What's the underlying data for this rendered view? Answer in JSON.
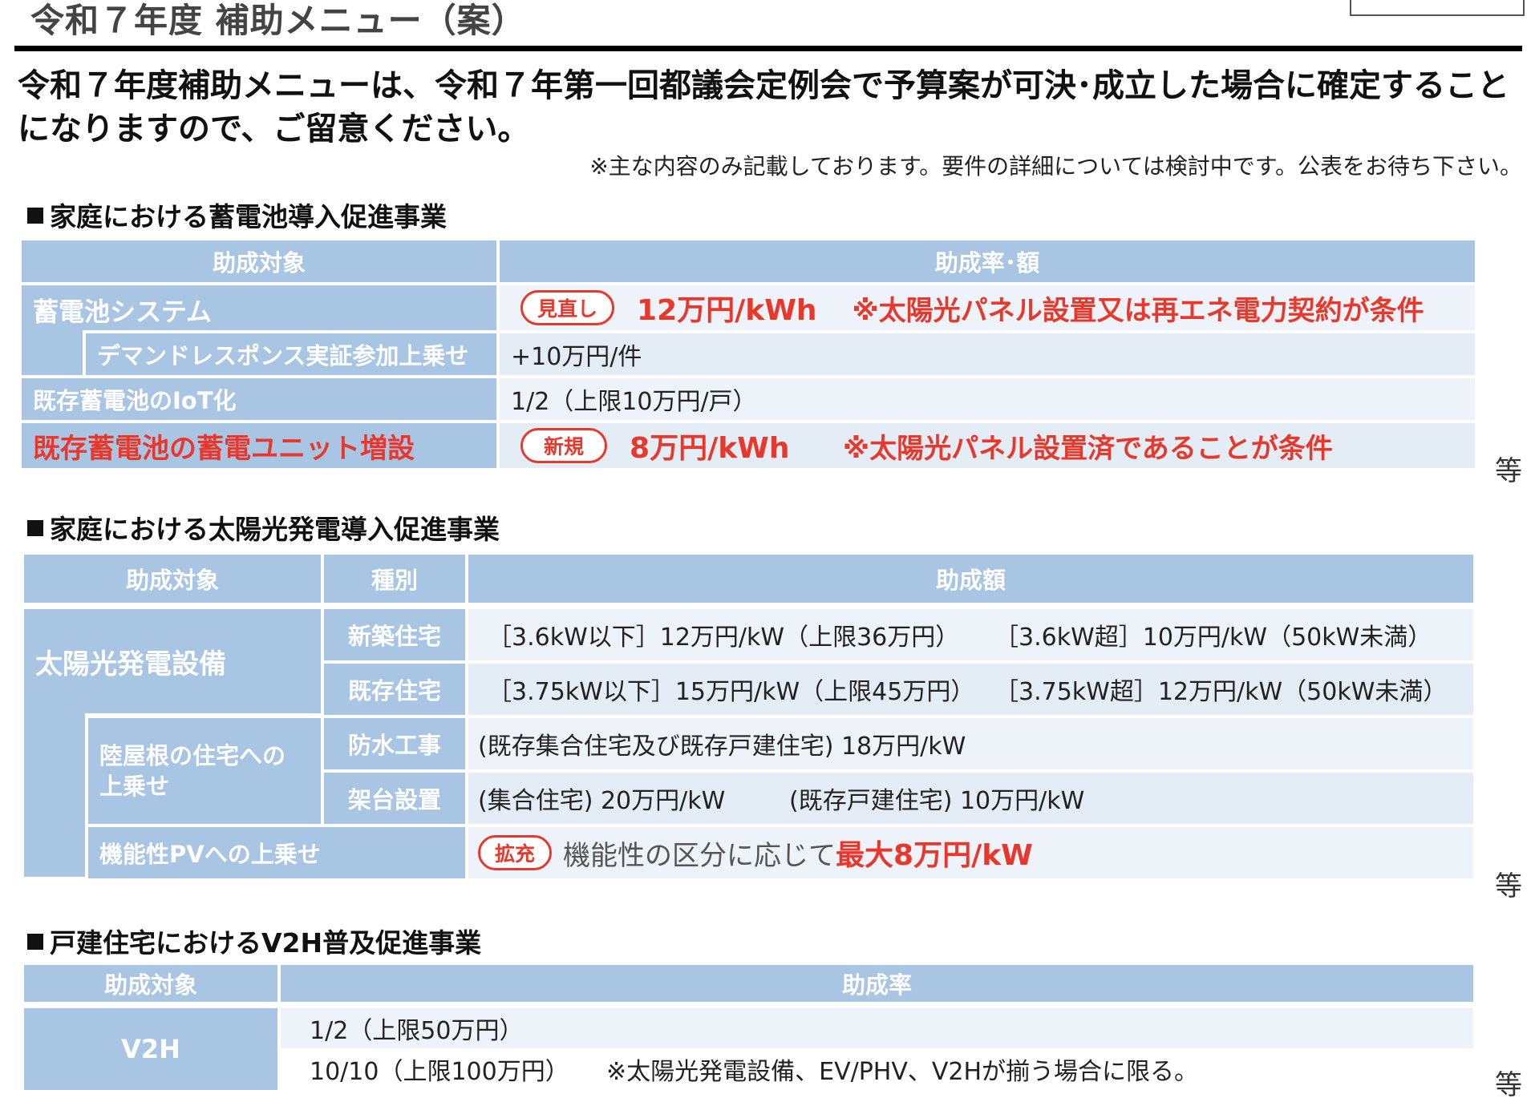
{
  "header": {
    "title": "令和７年度 補助メニュー（案）",
    "intro_line1": "令和７年度補助メニューは、令和７年第一回都議会定例会で予算案が可決･成立した場合に確定すること",
    "intro_line2": "になりますので、ご留意ください。",
    "note": "※主な内容のみ記載しております。要件の詳細については検討中です。公表をお待ち下さい。"
  },
  "battery": {
    "section_title": "家庭における蓄電池導入促進事業",
    "col_target": "助成対象",
    "col_rate": "助成率･額",
    "rows": [
      {
        "label": "蓄電池システム",
        "badge": "見直し",
        "amount": "12万円/kWh",
        "condition": "※太陽光パネル設置又は再エネ電力契約が条件"
      },
      {
        "label": "デマンドレスポンス実証参加上乗せ",
        "value": "+10万円/件"
      },
      {
        "label": "既存蓄電池のIoT化",
        "value": "1/2（上限10万円/戸）"
      },
      {
        "label": "既存蓄電池の蓄電ユニット増設",
        "badge": "新規",
        "amount": "8万円/kWh",
        "condition": "※太陽光パネル設置済であることが条件"
      }
    ],
    "etc": "等"
  },
  "solar": {
    "section_title": "家庭における太陽光発電導入促進事業",
    "col_target": "助成対象",
    "col_type": "種別",
    "col_amount": "助成額",
    "main_label": "太陽光発電設備",
    "new_house": {
      "type": "新築住宅",
      "a": "［3.6kW以下］12万円/kW（上限36万円）",
      "b": "［3.6kW超］10万円/kW（50kW未満）"
    },
    "existing_house": {
      "type": "既存住宅",
      "a": "［3.75kW以下］15万円/kW（上限45万円）",
      "b": "［3.75kW超］12万円/kW（50kW未満）"
    },
    "flat_roof_label_1": "陸屋根の住宅への",
    "flat_roof_label_2": "上乗せ",
    "waterproof": {
      "type": "防水工事",
      "value": "(既存集合住宅及び既存戸建住宅) 18万円/kW"
    },
    "mount": {
      "type": "架台設置",
      "a": "(集合住宅) 20万円/kW",
      "b": "(既存戸建住宅) 10万円/kW"
    },
    "pv": {
      "label": "機能性PVへの上乗せ",
      "badge": "拡充",
      "text": "機能性の区分に応じて",
      "amount": "最大8万円/kW"
    },
    "etc": "等"
  },
  "v2h": {
    "section_title": "戸建住宅におけるV2H普及促進事業",
    "col_target": "助成対象",
    "col_rate": "助成率",
    "label": "V2H",
    "line1": "1/2（上限50万円）",
    "line2_a": "10/10（上限100万円）",
    "line2_b": "※太陽光発電設備、EV/PHV、V2Hが揃う場合に限る。",
    "etc": "等"
  }
}
